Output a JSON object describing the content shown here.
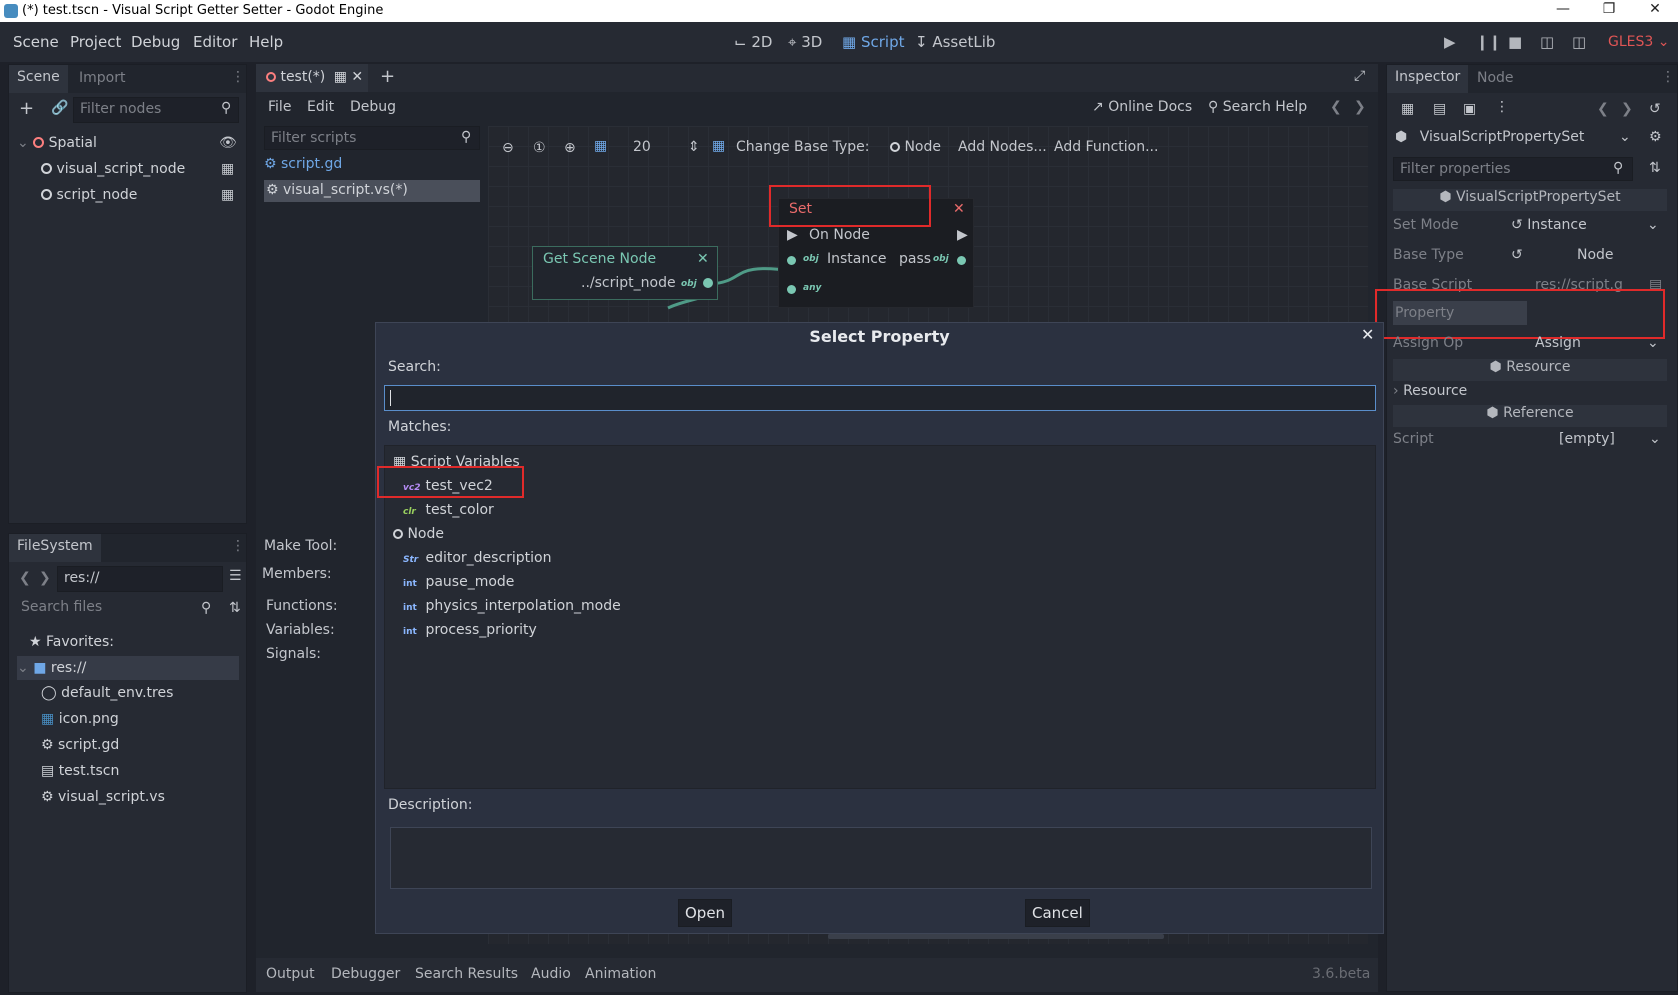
{
  "window": {
    "title": "(*) test.tscn - Visual Script Getter Setter - Godot Engine"
  },
  "menubar": {
    "menus": [
      "Scene",
      "Project",
      "Debug",
      "Editor",
      "Help"
    ],
    "workspaces": [
      "2D",
      "3D",
      "Script",
      "AssetLib"
    ],
    "active_workspace": "Script",
    "renderer": "GLES3"
  },
  "scene_dock": {
    "tabs": [
      "Scene",
      "Import"
    ],
    "filter_placeholder": "Filter nodes",
    "tree": [
      {
        "label": "Spatial"
      },
      {
        "label": "visual_script_node"
      },
      {
        "label": "script_node"
      }
    ]
  },
  "filesystem_dock": {
    "tab": "FileSystem",
    "path": "res://",
    "search_placeholder": "Search files",
    "items": [
      "Favorites:",
      "res://",
      "default_env.tres",
      "icon.png",
      "script.gd",
      "test.tscn",
      "visual_script.vs"
    ]
  },
  "editor": {
    "scene_tab": "test(*)",
    "script_menus": [
      "File",
      "Edit",
      "Debug"
    ],
    "online_docs": "Online Docs",
    "search_help": "Search Help",
    "filter_scripts_placeholder": "Filter scripts",
    "scripts": [
      "script.gd",
      "visual_script.vs(*)"
    ],
    "make_tool": "Make Tool:",
    "members": "Members:",
    "member_sections": [
      "Functions:",
      "Variables:",
      "Signals:"
    ],
    "toolbar": {
      "snap_value": "20",
      "change_base_type": "Change Base Type:",
      "base_type": "Node",
      "add_nodes": "Add Nodes...",
      "add_function": "Add Function..."
    },
    "set_node": {
      "title": "Set",
      "on_node": "On Node",
      "instance": "Instance",
      "pass": "pass",
      "obj_badge": "obj",
      "any_badge": "any"
    },
    "get_scene_node": {
      "title": "Get Scene Node",
      "path": "../script_node",
      "obj_badge": "obj"
    }
  },
  "bottom_panel": {
    "tabs": [
      "Output",
      "Debugger",
      "Search Results",
      "Audio",
      "Animation"
    ],
    "version": "3.6.beta"
  },
  "inspector": {
    "tabs": [
      "Inspector",
      "Node"
    ],
    "object": "VisualScriptPropertySet",
    "filter_placeholder": "Filter properties",
    "class_header": "VisualScriptPropertySet",
    "rows": [
      {
        "name": "Set Mode",
        "value": "Instance"
      },
      {
        "name": "Base Type",
        "value": "Node"
      },
      {
        "name": "Base Script",
        "value": "res://script.g"
      },
      {
        "name": "Property",
        "value": ""
      },
      {
        "name": "Assign Op",
        "value": "Assign"
      }
    ],
    "resource_header": "Resource",
    "resource_row": "Resource",
    "reference_header": "Reference",
    "script_row": {
      "name": "Script",
      "value": "[empty]"
    }
  },
  "dialog": {
    "title": "Select Property",
    "search_label": "Search:",
    "search_value": "",
    "matches_label": "Matches:",
    "matches": [
      {
        "label": "Script Variables",
        "kind": "group",
        "badge": ""
      },
      {
        "label": "test_vec2",
        "kind": "item",
        "badge": "vc2"
      },
      {
        "label": "test_color",
        "kind": "item",
        "badge": "clr"
      },
      {
        "label": "Node",
        "kind": "group",
        "badge": ""
      },
      {
        "label": "editor_description",
        "kind": "item",
        "badge": "Str"
      },
      {
        "label": "pause_mode",
        "kind": "item",
        "badge": "int"
      },
      {
        "label": "physics_interpolation_mode",
        "kind": "item",
        "badge": "int"
      },
      {
        "label": "process_priority",
        "kind": "item",
        "badge": "int"
      }
    ],
    "description_label": "Description:",
    "open_button": "Open",
    "cancel_button": "Cancel"
  },
  "colors": {
    "accent": "#6fa7e6",
    "highlight_box": "#e02a2a",
    "graph_node_border": "#3b6c5e"
  }
}
